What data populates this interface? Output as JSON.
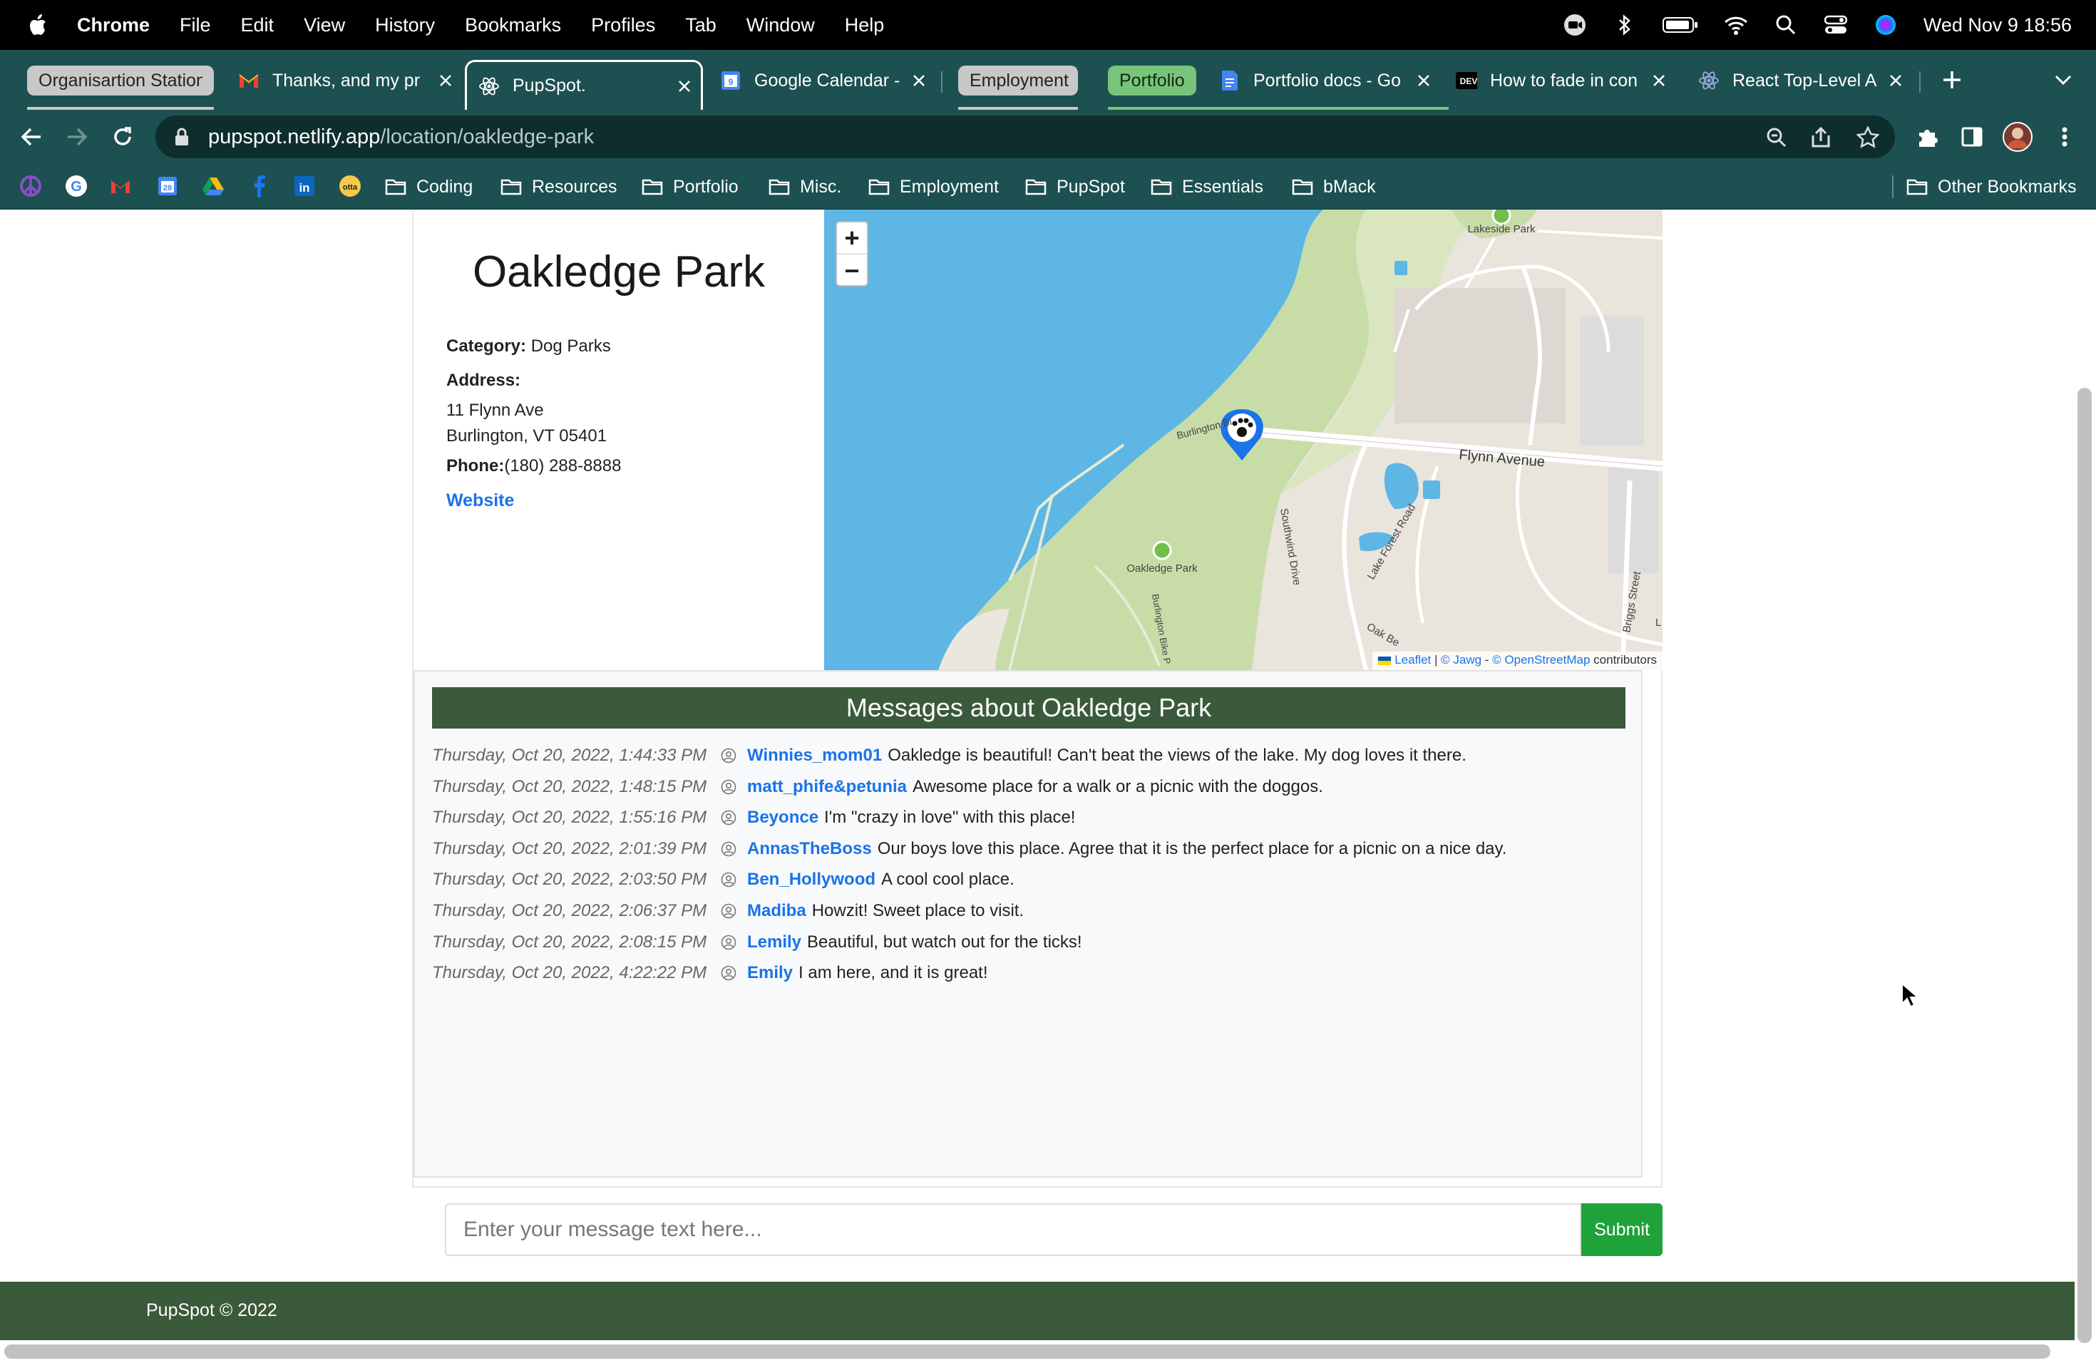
{
  "menubar": {
    "app_name": "Chrome",
    "items": [
      "File",
      "Edit",
      "View",
      "History",
      "Bookmarks",
      "Profiles",
      "Tab",
      "Window",
      "Help"
    ],
    "clock": "Wed Nov 9  18:56"
  },
  "tabs": {
    "group_organisation": "Organisartion Station",
    "gmail": "Thanks, and my pr",
    "pupspot": "PupSpot.",
    "calendar": "Google Calendar -",
    "group_employment": "Employment",
    "group_portfolio": "Portfolio",
    "portfolio_docs": "Portfolio docs - Go",
    "dev": "How to fade in con",
    "react": "React Top-Level A"
  },
  "omnibox": {
    "host": "pupspot.netlify.app",
    "path": "/location/oakledge-park"
  },
  "bookmarks": {
    "folders": [
      "Coding",
      "Resources",
      "Portfolio",
      "Misc.",
      "Employment",
      "PupSpot",
      "Essentials",
      "bMack"
    ],
    "other": "Other Bookmarks"
  },
  "location": {
    "title": "Oakledge Park",
    "category_label": "Category:",
    "category": "Dog Parks",
    "address_label": "Address:",
    "address_line1": "11 Flynn Ave",
    "address_line2": "Burlington, VT 05401",
    "phone_label": "Phone:",
    "phone": "(180) 288-8888",
    "website_label": "Website"
  },
  "map": {
    "zoom_in": "+",
    "zoom_out": "−",
    "labels": {
      "lakeside": "Lakeside Park",
      "flynn": "Flynn Avenue",
      "burlington_bike": "Burlington Bi",
      "oakledge": "Oakledge Park",
      "southwind": "Southwind Drive",
      "lake_forest": "Lake Forest Road",
      "briggs": "Briggs Street",
      "oak_beach": "Oak Be",
      "burlington_bike2": "Burlington Bike P",
      "l": "L"
    },
    "attribution": {
      "leaflet": "Leaflet",
      "jawg": "© Jawg",
      "osm": "© OpenStreetMap",
      "contributors": "contributors"
    }
  },
  "messages": {
    "header": "Messages about Oakledge Park",
    "items": [
      {
        "time": "Thursday, Oct 20, 2022, 1:44:33 PM",
        "user": "Winnies_mom01",
        "text": "Oakledge is beautiful! Can't beat the views of the lake. My dog loves it there."
      },
      {
        "time": "Thursday, Oct 20, 2022, 1:48:15 PM",
        "user": "matt_phife&petunia",
        "text": "Awesome place for a walk or a picnic with the doggos."
      },
      {
        "time": "Thursday, Oct 20, 2022, 1:55:16 PM",
        "user": "Beyonce",
        "text": "I'm \"crazy in love\" with this place!"
      },
      {
        "time": "Thursday, Oct 20, 2022, 2:01:39 PM",
        "user": "AnnasTheBoss",
        "text": "Our boys love this place. Agree that it is the perfect place for a picnic on a nice day."
      },
      {
        "time": "Thursday, Oct 20, 2022, 2:03:50 PM",
        "user": "Ben_Hollywood",
        "text": "A cool cool place."
      },
      {
        "time": "Thursday, Oct 20, 2022, 2:06:37 PM",
        "user": "Madiba",
        "text": "Howzit! Sweet place to visit."
      },
      {
        "time": "Thursday, Oct 20, 2022, 2:08:15 PM",
        "user": "Lemily",
        "text": "Beautiful, but watch out for the ticks!"
      },
      {
        "time": "Thursday, Oct 20, 2022, 4:22:22 PM",
        "user": "Emily",
        "text": "I am here, and it is great!"
      }
    ]
  },
  "compose": {
    "placeholder": "Enter your message text here...",
    "submit_label": "Submit"
  },
  "footer": {
    "text": "PupSpot © 2022"
  },
  "colors": {
    "chrome_frame": "#1d5050",
    "brand_green": "#3b5a3b",
    "submit_green": "#1fa23a",
    "link_blue": "#1a73e8",
    "lake_blue": "#5eb6e4"
  }
}
